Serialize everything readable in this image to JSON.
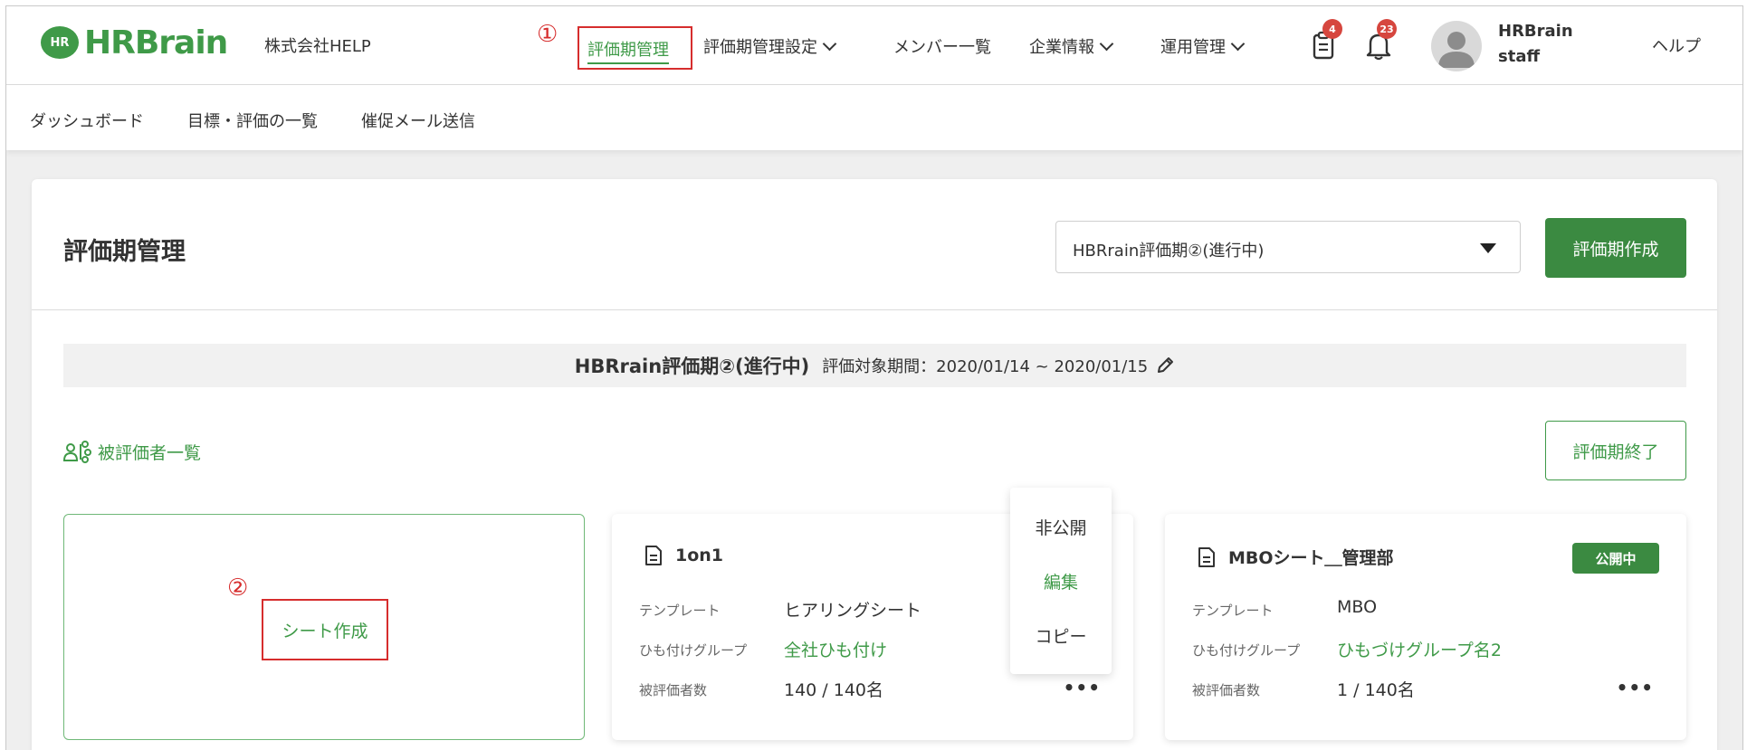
{
  "header": {
    "logo_badge": "HR",
    "logo_text": "HRBrain",
    "company": "株式会社HELP",
    "annotation_1": "①",
    "nav_active": "評価期管理",
    "nav": [
      "評価期管理設定",
      "メンバー一覧",
      "企業情報",
      "運用管理"
    ],
    "clipboard_badge": "4",
    "bell_badge": "23",
    "user_name_line1": "HRBrain",
    "user_name_line2": "staff",
    "help": "ヘルプ"
  },
  "subnav": [
    "ダッシュボード",
    "目標・評価の一覧",
    "催促メール送信"
  ],
  "main": {
    "title": "評価期管理",
    "period_select": "HBRrain評価期②(進行中)",
    "create_button": "評価期作成",
    "info_title": "HBRrain評価期②(進行中)",
    "info_period": "評価対象期間：2020/01/14 ~ 2020/01/15",
    "evaluee_list": "被評価者一覧",
    "end_button": "評価期終了",
    "annotation_2": "②",
    "new_sheet": "シート作成"
  },
  "sheets": [
    {
      "title": "1on1",
      "template_label": "テンプレート",
      "template": "ヒアリングシート",
      "group_label": "ひも付けグループ",
      "group": "全社ひも付け",
      "count_label": "被評価者数",
      "count": "140 / 140名",
      "more": "•••"
    },
    {
      "title": "MBOシート＿管理部",
      "status": "公開中",
      "template_label": "テンプレート",
      "template": "MBO",
      "group_label": "ひも付けグループ",
      "group": "ひもづけグループ名2",
      "count_label": "被評価者数",
      "count": "1 / 140名",
      "more": "•••"
    }
  ],
  "context_menu": [
    "非公開",
    "編集",
    "コピー"
  ],
  "colors": {
    "brand_green": "#3f9a48",
    "button_green": "#3b8a41",
    "annotation_red": "#d62d2d",
    "badge_red": "#d6463e"
  }
}
